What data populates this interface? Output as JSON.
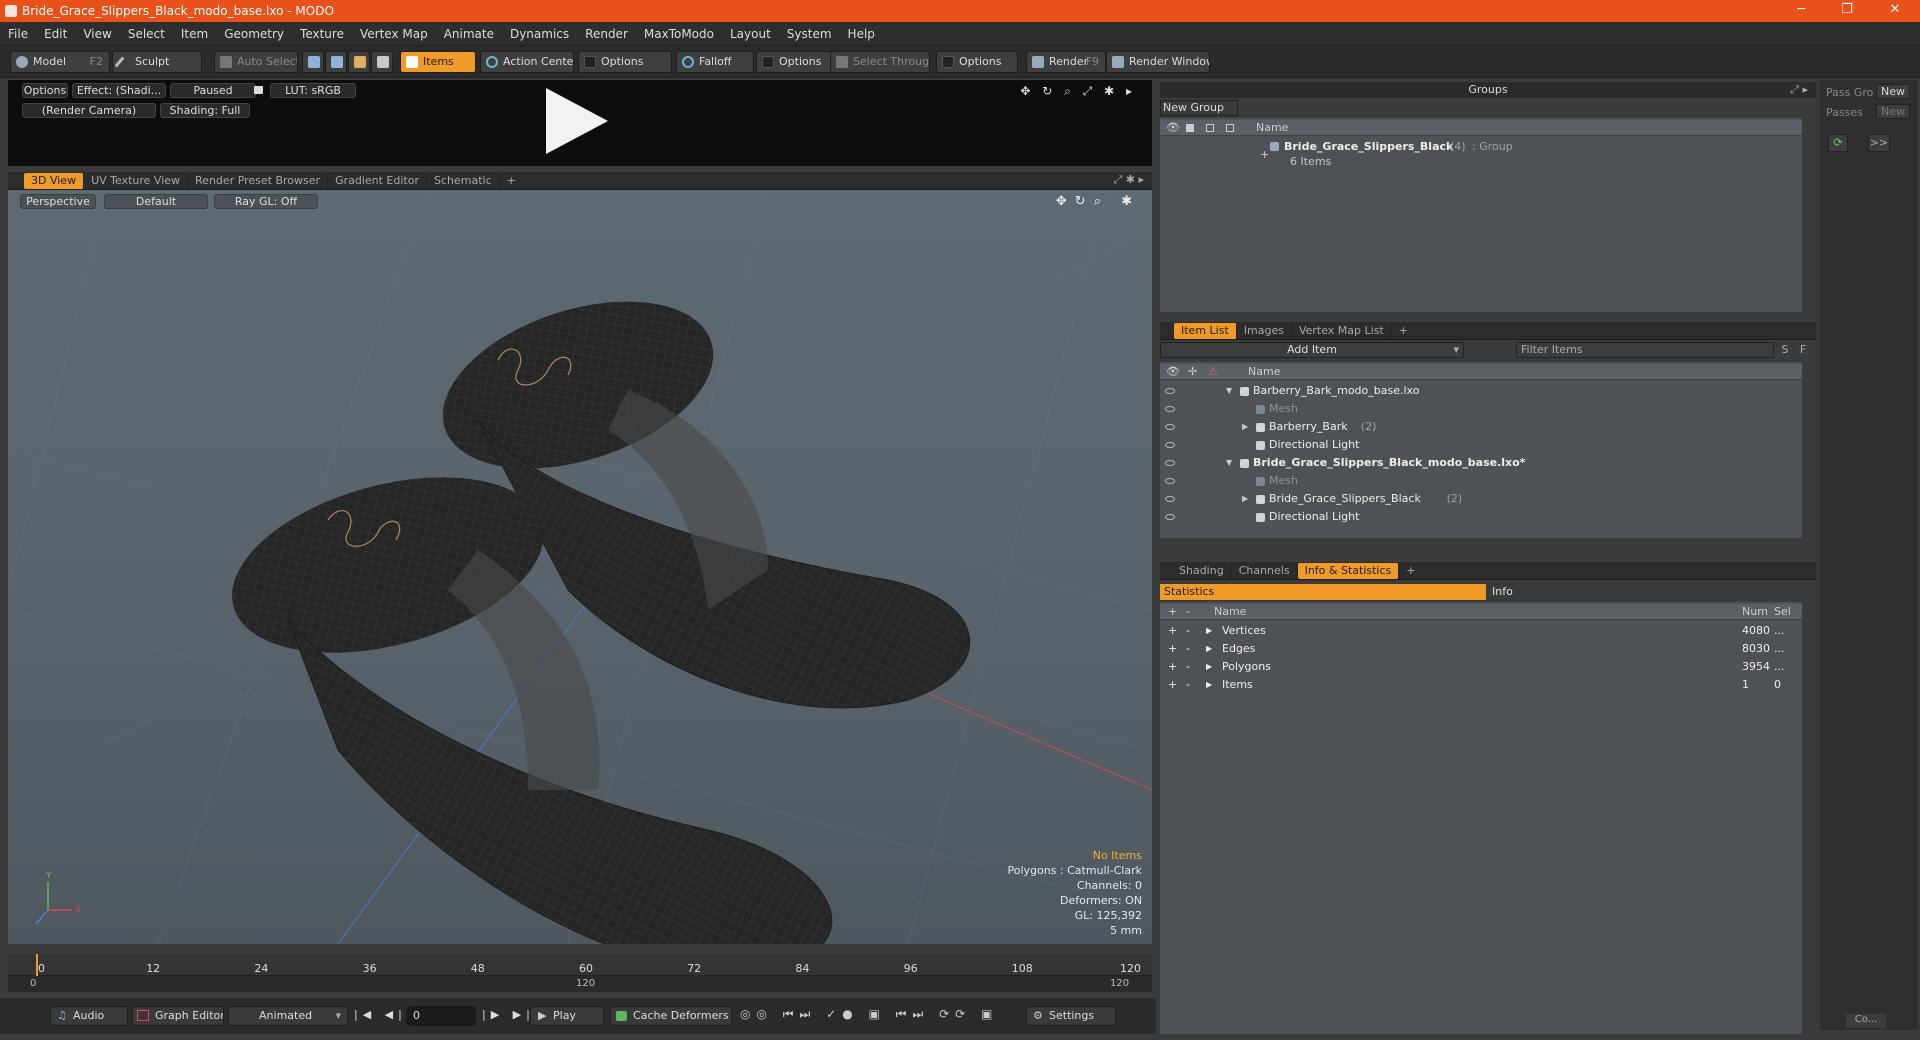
{
  "window": {
    "title": "Bride_Grace_Slippers_Black_modo_base.lxo - MODO",
    "min": "─",
    "max": "❐",
    "close": "✕"
  },
  "menu": [
    "File",
    "Edit",
    "View",
    "Select",
    "Item",
    "Geometry",
    "Texture",
    "Vertex Map",
    "Animate",
    "Dynamics",
    "Render",
    "MaxToModo",
    "Layout",
    "System",
    "Help"
  ],
  "toolbar": {
    "model": "Model",
    "model_key": "F2",
    "sculpt": "Sculpt",
    "auto_select": "Auto Select",
    "items": "Items",
    "action_center": "Action Center",
    "options1": "Options",
    "falloff": "Falloff",
    "options2": "Options",
    "select_through": "Select Through",
    "options3": "Options",
    "render": "Render",
    "render_key": "F9",
    "render_window": "Render Window"
  },
  "preview": {
    "options": "Options",
    "effect": "Effect: (Shadi...",
    "paused": "Paused",
    "lut": "LUT: sRGB",
    "camera": "(Render Camera)",
    "shading": "Shading: Full"
  },
  "viewtabs": [
    "3D View",
    "UV Texture View",
    "Render Preset Browser",
    "Gradient Editor",
    "Schematic",
    "+"
  ],
  "viewport": {
    "perspective": "Perspective",
    "default": "Default",
    "raygl": "Ray GL: Off",
    "info": {
      "no_items": "No Items",
      "polygons": "Polygons : Catmull-Clark",
      "channels": "Channels: 0",
      "deformers": "Deformers: ON",
      "gl": "GL: 125,392",
      "scale": "5 mm"
    },
    "axis_x": "X",
    "axis_y": "Y"
  },
  "timeline": {
    "ticks": [
      "0",
      "12",
      "24",
      "36",
      "48",
      "60",
      "72",
      "84",
      "96",
      "108",
      "120"
    ],
    "start": "0",
    "mid": "120",
    "end": "120"
  },
  "bottom": {
    "audio": "Audio",
    "graph_editor": "Graph Editor",
    "animated": "Animated",
    "frame": "0",
    "play": "Play",
    "cache": "Cache Deformers",
    "settings": "Settings"
  },
  "groups": {
    "title": "Groups",
    "new_group": "New Group",
    "col_name": "Name",
    "item_name": "Bride_Grace_Slippers_Black",
    "item_count": "(4)",
    "item_type": ": Group",
    "item_sub": "6 Items"
  },
  "passes": {
    "pass_group": "Pass Gro",
    "new1": "New",
    "passes": "Passes",
    "new2": "New",
    "more": ">>",
    "co": "Co..."
  },
  "itemlist": {
    "tabs": [
      "Item List",
      "Images",
      "Vertex Map List",
      "+"
    ],
    "add_item": "Add Item",
    "filter": "Filter Items",
    "s": "S",
    "f": "F",
    "col_name": "Name",
    "rows": [
      {
        "label": "Barberry_Bark_modo_base.lxo",
        "extra": "",
        "indent": 0,
        "style": "normal",
        "arrow": "▼"
      },
      {
        "label": "Mesh",
        "extra": "",
        "indent": 2,
        "style": "gray",
        "arrow": ""
      },
      {
        "label": "Barberry_Bark",
        "extra": "(2)",
        "indent": 2,
        "style": "normal",
        "arrow": "▶"
      },
      {
        "label": "Directional Light",
        "extra": "",
        "indent": 2,
        "style": "normal",
        "arrow": ""
      },
      {
        "label": "Bride_Grace_Slippers_Black_modo_base.lxo*",
        "extra": "",
        "indent": 0,
        "style": "bold",
        "arrow": "▼"
      },
      {
        "label": "Mesh",
        "extra": "",
        "indent": 2,
        "style": "gray",
        "arrow": ""
      },
      {
        "label": "Bride_Grace_Slippers_Black",
        "extra": "(2)",
        "indent": 2,
        "style": "normal",
        "arrow": "▶"
      },
      {
        "label": "Directional Light",
        "extra": "",
        "indent": 2,
        "style": "normal",
        "arrow": ""
      }
    ]
  },
  "stats": {
    "tabs": [
      "Shading",
      "Channels",
      "Info & Statistics",
      "+"
    ],
    "statistics": "Statistics",
    "info": "Info",
    "cols": {
      "name": "Name",
      "num": "Num",
      "sel": "Sel"
    },
    "rows": [
      {
        "name": "Vertices",
        "num": "4080",
        "sel": "..."
      },
      {
        "name": "Edges",
        "num": "8030",
        "sel": "..."
      },
      {
        "name": "Polygons",
        "num": "3954",
        "sel": "..."
      },
      {
        "name": "Items",
        "num": "1",
        "sel": "0"
      }
    ]
  },
  "colors": {
    "accent": "#f09a28",
    "titlebar": "#e8521a"
  }
}
